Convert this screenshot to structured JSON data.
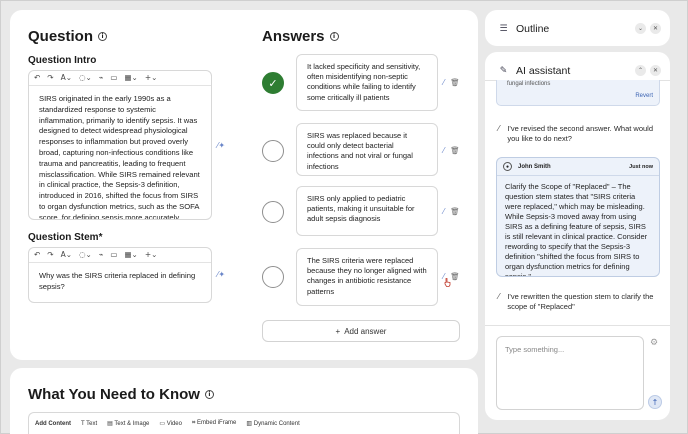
{
  "question": {
    "title": "Question",
    "intro_label": "Question Intro",
    "intro_text": "SIRS originated in the early 1990s as a standardized response to systemic inflammation, primarily to identify sepsis. It was designed to detect widespread physiological responses to inflammation but proved overly broad, capturing non-infectious conditions like trauma and pancreatitis, leading to frequent misclassification. While SIRS remained relevant in clinical practice, the Sepsis-3 definition, introduced in 2016, shifted the focus from SIRS to organ dysfunction metrics, such as the SOFA score, for defining sepsis more accurately",
    "stem_label": "Question Stem*",
    "stem_text": "Why was the SIRS criteria replaced in defining sepsis?",
    "toolbar": [
      "↶",
      "↷",
      "A⌄",
      "◌⌄",
      "⌁",
      "▭",
      "▦⌄",
      "+⌄"
    ]
  },
  "answers": {
    "title": "Answers",
    "items": [
      {
        "text": "It lacked specificity and sensitivity, often misidentifying non-septic conditions while failing to identify some critically ill patients",
        "correct": true
      },
      {
        "text": "SIRS was replaced because it could only detect bacterial infections and not viral or fungal infections",
        "correct": false
      },
      {
        "text": "SIRS only applied to pediatric patients, making it unsuitable for adult sepsis diagnosis",
        "correct": false
      },
      {
        "text": "The SIRS criteria were replaced because they no longer aligned with changes in antibiotic resistance patterns",
        "correct": false
      }
    ],
    "add_label": "Add answer",
    "add_icon": "+"
  },
  "know": {
    "title": "What You Need to Know",
    "bar": {
      "add_content": "Add Content",
      "text": "Text",
      "text_image": "Text & Image",
      "video": "Video",
      "embed": "Embed iFrame",
      "dynamic": "Dynamic Content"
    }
  },
  "outline": {
    "title": "Outline"
  },
  "ai": {
    "title": "AI assistant",
    "prev_snippet": "fungal infections",
    "revert_label": "Revert",
    "msg1": "I've revised the second answer. What would you like to do next?",
    "user_name": "John Smith",
    "user_time": "Just now",
    "user_text": "Clarify the Scope of \"Replaced\" – The question stem states that \"SIRS criteria were replaced,\" which may be misleading. While Sepsis-3 moved away from using SIRS as a defining feature of sepsis, SIRS is still relevant in clinical practice. Consider rewording to specify that the Sepsis-3 definition \"shifted the focus from SIRS to organ dysfunction metrics for defining sepsis.\"",
    "msg2": "I've rewritten the question stem to clarify the scope of \"Replaced\"",
    "input_placeholder": "Type something..."
  },
  "colors": {
    "correct": "#2e7d32",
    "accent": "#3a62b5",
    "user_bg": "#edf2fa"
  }
}
